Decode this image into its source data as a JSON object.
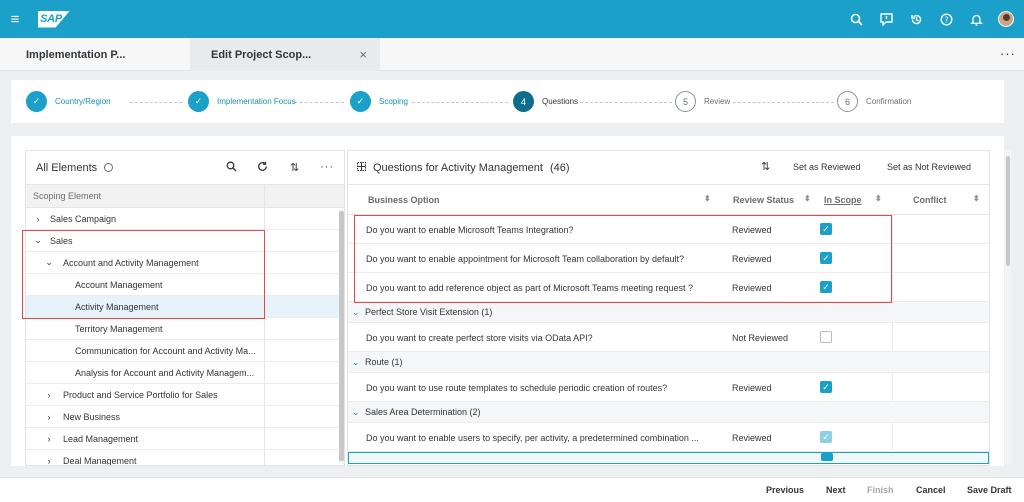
{
  "shell": {
    "logo": "SAP",
    "icons": [
      "search-icon",
      "feedback-icon",
      "history-icon",
      "help-icon",
      "notification-icon",
      "user-avatar"
    ]
  },
  "tabs": [
    {
      "label": "Implementation P..."
    },
    {
      "label": "Edit Project Scop...",
      "close": "×"
    }
  ],
  "tab_overflow": "···",
  "wizard": {
    "steps": [
      {
        "number": "✓",
        "label": "Country/Region",
        "state": "done"
      },
      {
        "number": "✓",
        "label": "Implementation Focus",
        "state": "done"
      },
      {
        "number": "✓",
        "label": "Scoping",
        "state": "done"
      },
      {
        "number": "4",
        "label": "Questions",
        "state": "current"
      },
      {
        "number": "5",
        "label": "Review",
        "state": "todo"
      },
      {
        "number": "6",
        "label": "Confirmation",
        "state": "todo"
      }
    ]
  },
  "left_panel": {
    "title": "All Elements",
    "column_header": "Scoping Element",
    "rows": [
      {
        "label": "Sales Campaign",
        "chevron": "›"
      },
      {
        "label": "Sales",
        "chevron": "⌄"
      },
      {
        "label": "Account and Activity Management",
        "chevron": "⌄"
      },
      {
        "label": "Account Management",
        "chevron": ""
      },
      {
        "label": "Activity Management",
        "chevron": ""
      },
      {
        "label": "Territory Management",
        "chevron": ""
      },
      {
        "label": "Communication for Account and Activity Ma...",
        "chevron": ""
      },
      {
        "label": "Analysis for Account and Activity Managem...",
        "chevron": ""
      },
      {
        "label": "Product and Service Portfolio for Sales",
        "chevron": "›"
      },
      {
        "label": "New Business",
        "chevron": "›"
      },
      {
        "label": "Lead Management",
        "chevron": "›"
      },
      {
        "label": "Deal Management",
        "chevron": "›"
      }
    ]
  },
  "right_panel": {
    "title": "Questions for Activity Management",
    "count": "(46)",
    "sort_icon": "⇅",
    "set_reviewed": "Set as Reviewed",
    "set_not_reviewed": "Set as Not Reviewed",
    "columns": {
      "business_option": "Business Option",
      "review_status": "Review Status",
      "in_scope": "In Scope",
      "conflict": "Conflict"
    },
    "rows": [
      {
        "question": "Do you want to enable Microsoft Teams Integration?",
        "status": "Reviewed",
        "in_scope": true
      },
      {
        "question": "Do you want to enable appointment for Microsoft Team collaboration by default?",
        "status": "Reviewed",
        "in_scope": true
      },
      {
        "question": "Do you want to add reference object as part of Microsoft Teams meeting request ?",
        "status": "Reviewed",
        "in_scope": true
      }
    ],
    "groups": [
      {
        "label": "Perfect Store Visit Extension (1)",
        "rows": [
          {
            "question": "Do you want to create perfect store visits via OData API?",
            "status": "Not Reviewed",
            "in_scope": false
          }
        ]
      },
      {
        "label": "Route (1)",
        "rows": [
          {
            "question": "Do you want to use route templates to schedule periodic creation of routes?",
            "status": "Reviewed",
            "in_scope": true
          }
        ]
      },
      {
        "label": "Sales Area Determination (2)",
        "rows": [
          {
            "question": "Do you want to enable users to specify, per activity, a predetermined combination ...",
            "status": "Reviewed",
            "in_scope": true
          }
        ]
      }
    ]
  },
  "footer": {
    "previous": "Previous",
    "next": "Next",
    "finish": "Finish",
    "cancel": "Cancel",
    "save_draft": "Save Draft"
  }
}
